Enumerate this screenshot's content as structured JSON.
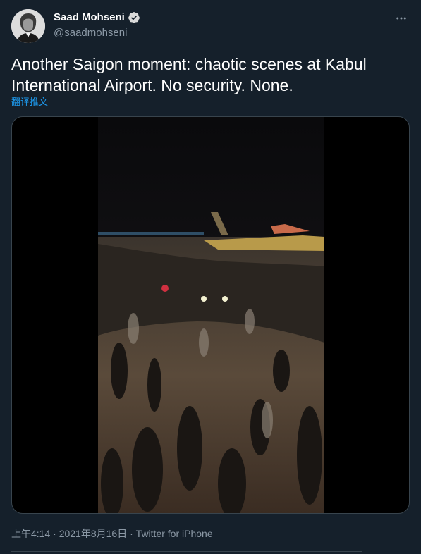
{
  "author": {
    "name": "Saad Mohseni",
    "handle": "@saadmohseni",
    "verified": true
  },
  "tweet": {
    "text": "Another Saigon moment: chaotic scenes at Kabul International Airport. No security. None.",
    "translate_label": "翻译推文"
  },
  "meta": {
    "time": "上午4:14",
    "separator1": "·",
    "date": "2021年8月16日",
    "separator2": "·",
    "source": "Twitter for iPhone"
  },
  "icons": {
    "verified": "verified-badge-icon",
    "more": "more-horizontal-icon"
  },
  "colors": {
    "background": "#15202b",
    "link": "#1d9bf0",
    "secondary_text": "#8b98a5",
    "border": "#38444d"
  }
}
